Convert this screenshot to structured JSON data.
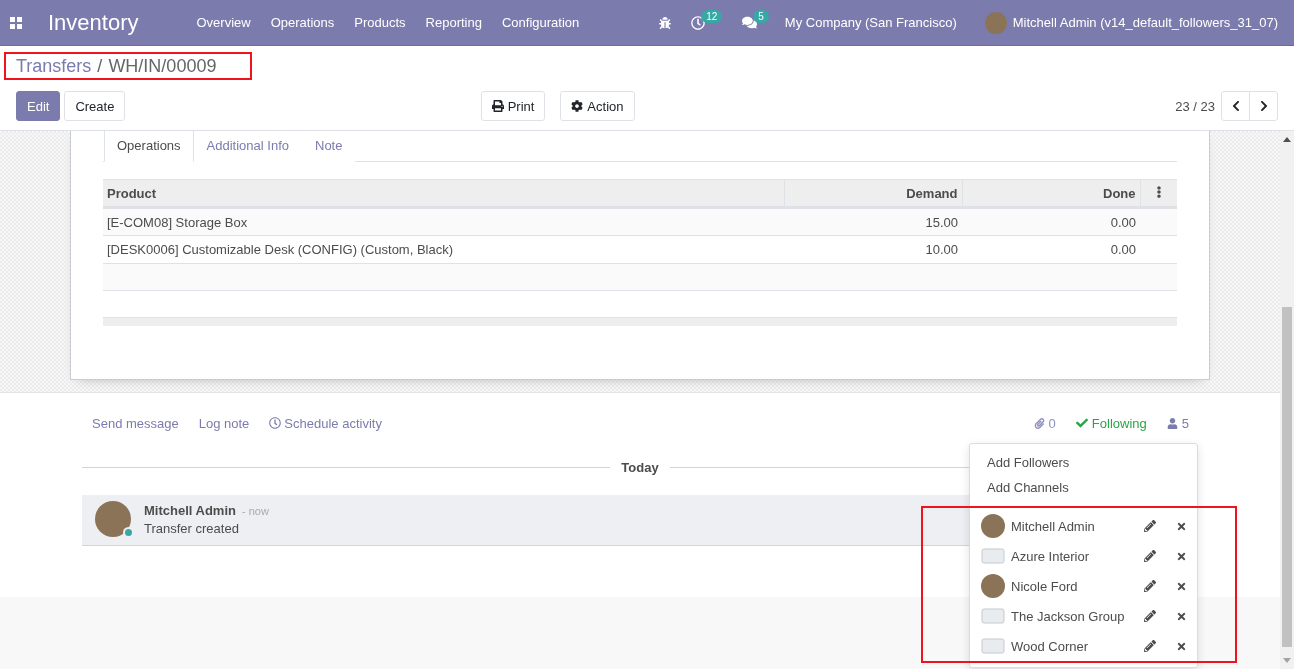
{
  "navbar": {
    "app_name": "Inventory",
    "menus": [
      "Overview",
      "Operations",
      "Products",
      "Reporting",
      "Configuration"
    ],
    "activity_count": "12",
    "message_count": "5",
    "company": "My Company (San Francisco)",
    "user": "Mitchell Admin (v14_default_followers_31_07)"
  },
  "breadcrumb": {
    "highlighted": true,
    "items": [
      "Transfers",
      "WH/IN/00009"
    ],
    "separator": "/"
  },
  "buttons": [
    {
      "label": "Edit",
      "kind": "primary"
    },
    {
      "label": "Create",
      "kind": "secondary"
    }
  ],
  "action_menus": [
    {
      "label": "Print",
      "kind": "print"
    },
    {
      "label": "Action",
      "kind": "gear"
    }
  ],
  "pager": {
    "value": "23 / 23"
  },
  "tabs": [
    {
      "label": "Operations",
      "selected": true
    },
    {
      "label": "Additional Info",
      "selected": false
    },
    {
      "label": "Note",
      "selected": false
    }
  ],
  "table": {
    "columns": [
      {
        "label": "Product",
        "kind": "text"
      },
      {
        "label": "Demand",
        "kind": "number"
      },
      {
        "label": "Done",
        "kind": "number"
      }
    ],
    "rows": [
      [
        "[E-COM08] Storage Box",
        "15.00",
        "0.00"
      ],
      [
        "[DESK0006] Customizable Desk (CONFIG) (Custom, Black)",
        "10.00",
        "0.00"
      ]
    ]
  },
  "chatter": {
    "actions": [
      {
        "label": "Send message",
        "kind": "link"
      },
      {
        "label": "Log note",
        "kind": "link"
      },
      {
        "label": "Schedule activity",
        "kind": "activity"
      }
    ],
    "attachments": "0",
    "following": true,
    "following_label": "Following",
    "followers_count": "5",
    "date_separator": "Today",
    "messages": [
      {
        "author": "Mitchell Admin",
        "time": "- now",
        "body": "Transfer created",
        "online": true
      }
    ]
  },
  "followers_menu": {
    "highlighted": true,
    "actions": [
      "Add Followers",
      "Add Channels"
    ],
    "followers": [
      {
        "name": "Mitchell Admin",
        "kind": "person"
      },
      {
        "name": "Azure Interior",
        "kind": "company"
      },
      {
        "name": "Nicole Ford",
        "kind": "person"
      },
      {
        "name": "The Jackson Group",
        "kind": "company"
      },
      {
        "name": "Wood Corner",
        "kind": "company"
      }
    ]
  }
}
